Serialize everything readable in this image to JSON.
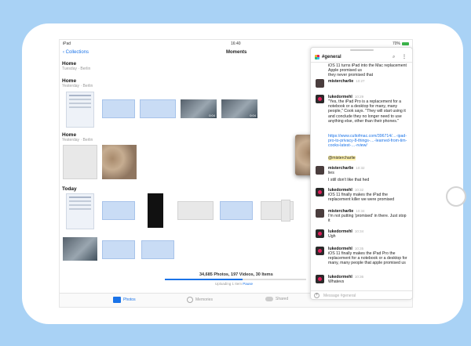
{
  "status": {
    "device": "iPad",
    "time": "16:40",
    "battery": "70%"
  },
  "nav": {
    "back_label": "Collections",
    "title": "Moments"
  },
  "sections": [
    {
      "title": "Home",
      "subtitle": "Tuesday · Berlin"
    },
    {
      "title": "Home",
      "subtitle": "Yesterday · Berlin"
    },
    {
      "title": "Home",
      "subtitle": "Yesterday · Berlin"
    },
    {
      "title": "Today",
      "subtitle": ""
    }
  ],
  "videos": [
    "0:04",
    "0:04"
  ],
  "summary": {
    "counts": "34,685 Photos, 197 Videos, 30 Items",
    "uploading": "Uploading 1 Item",
    "pause": "Pause"
  },
  "tabs": {
    "photos": "Photos",
    "memories": "Memories",
    "shared": "Shared"
  },
  "drag": {
    "badge": "1"
  },
  "slack": {
    "channel": "#general",
    "messages": [
      {
        "text": "iOS 11 turns iPad into the Mac replacement Apple promised us"
      },
      {
        "text": "they never promised that"
      },
      {
        "user": "mistercharlie",
        "time": "10:27",
        "text": ""
      },
      {
        "user": "lukedormehl",
        "time": "10:29",
        "text": "\"Yes, the iPad Pro is a replacement for a notebook or a desktop for many, many people,\" Cook says. \"They will start using it and conclude they no longer need to use anything else, other than their phones.\""
      },
      {
        "link": "https://www.cultofmac.com/396714/…-ipad-pro-to-privacy-8-things-…-learned-from-tim-cooks-latest-…-rview/",
        "mention": "@mistercharlie"
      },
      {
        "user": "mistercharlie",
        "time": "10:32",
        "text": "lies"
      },
      {
        "text": "I still don't like that hed"
      },
      {
        "user": "lukedormehl",
        "time": "10:32",
        "text": "iOS 11 finally makes the iPad the replacement killer we were promised"
      },
      {
        "user": "mistercharlie",
        "time": "10:34",
        "text": "I'm not putting 'promised' in there. Just stop it"
      },
      {
        "user": "lukedormehl",
        "time": "10:34",
        "text": "Ugh"
      },
      {
        "user": "lukedormehl",
        "time": "10:35",
        "text": "iOS 11 finally makes the iPad Pro the replacement for a notebook or a desktop for many, many people that apple promised us"
      },
      {
        "user": "lukedormehl",
        "time": "10:36",
        "text": "Whatevs"
      }
    ],
    "compose_placeholder": "Message #general"
  }
}
